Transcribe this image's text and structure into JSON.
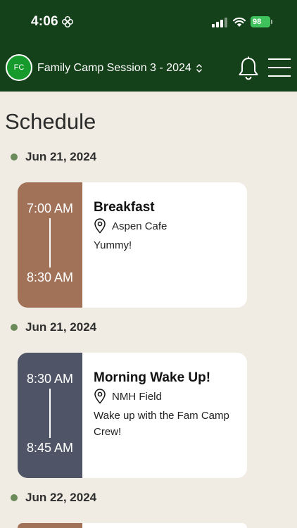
{
  "status_bar": {
    "time": "4:06",
    "battery": "98"
  },
  "header": {
    "avatar_initials": "FC",
    "session_title": "Family Camp Session 3 - 2024"
  },
  "page_title": "Schedule",
  "schedule": [
    {
      "date": "Jun 21, 2024",
      "event": {
        "start": "7:00 AM",
        "end": "8:30 AM",
        "title": "Breakfast",
        "location": "Aspen Cafe",
        "description": "Yummy!",
        "color": "#a27258"
      }
    },
    {
      "date": "Jun 21, 2024",
      "event": {
        "start": "8:30 AM",
        "end": "8:45 AM",
        "title": "Morning Wake Up!",
        "location": "NMH Field",
        "description": "Wake up with the Fam Camp Crew!",
        "color": "#4f5567"
      }
    },
    {
      "date": "Jun 22, 2024",
      "event": {
        "color": "#a27258"
      }
    }
  ],
  "icons": [
    "flower-icon",
    "signal-icon",
    "wifi-icon",
    "battery-icon",
    "chevron-updown-icon",
    "bell-icon",
    "hamburger-menu-icon",
    "location-pin-icon"
  ],
  "colors": {
    "header_bg": "#14401a",
    "page_bg": "#f0ece3",
    "avatar_bg": "#169a2c",
    "date_dot": "#6a8a5a"
  }
}
